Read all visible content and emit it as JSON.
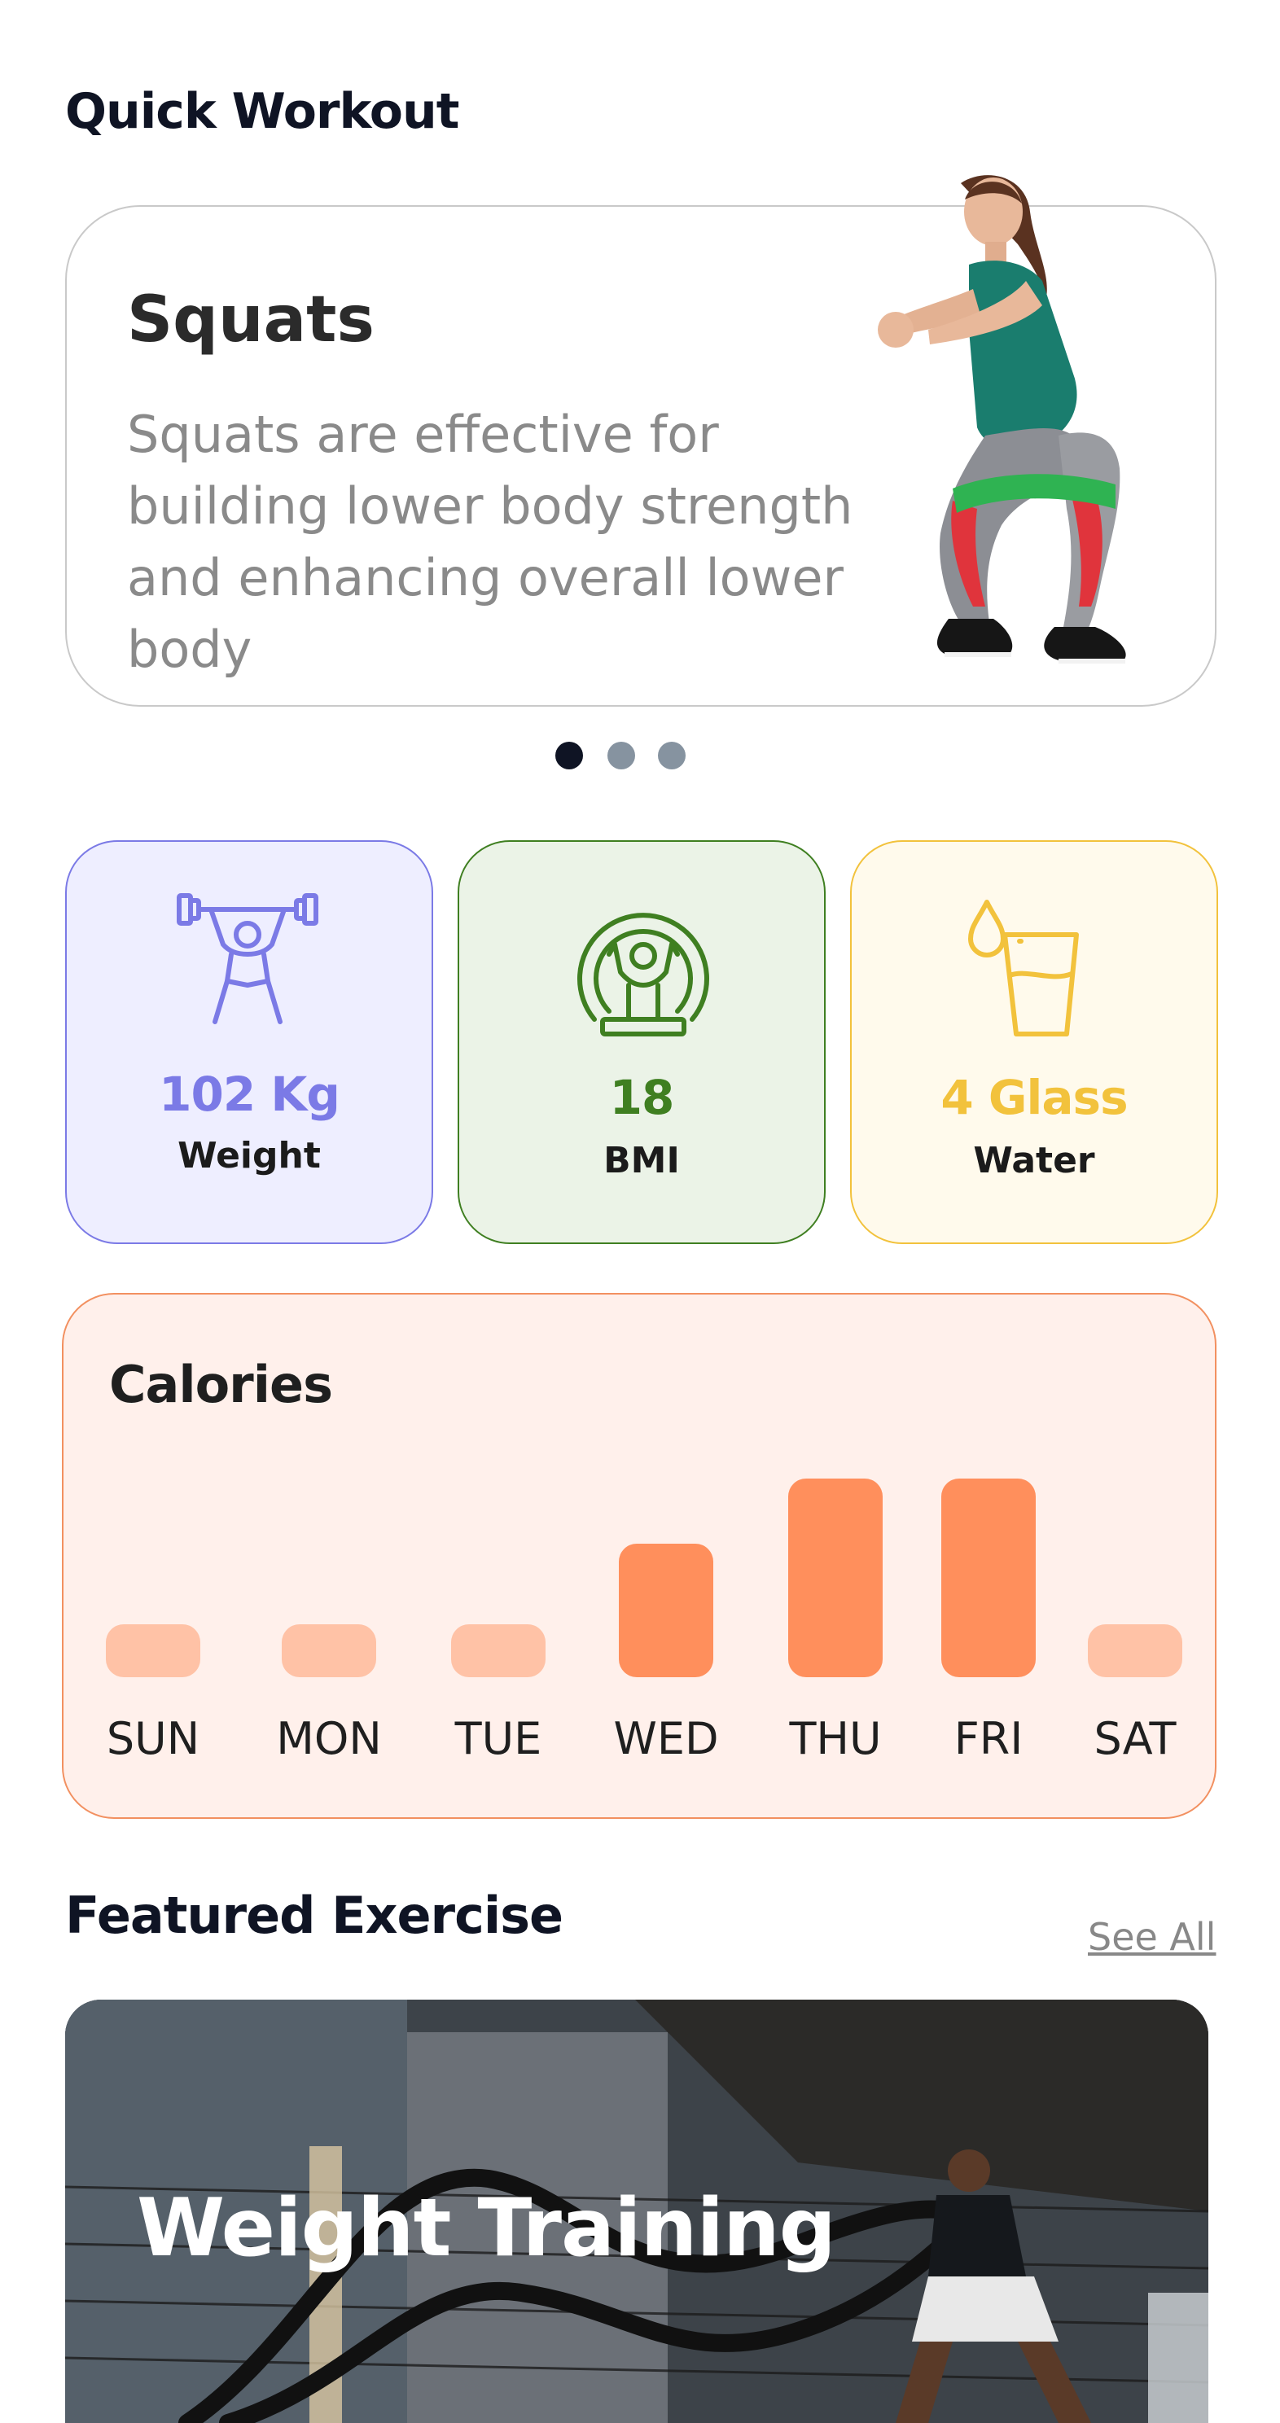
{
  "quick_workout": {
    "section_title": "Quick Workout",
    "card": {
      "title": "Squats",
      "description": "Squats are effective for building lower body strength and enhancing overall lower body"
    },
    "carousel_dots": 3,
    "active_dot": 0
  },
  "stats": [
    {
      "value": "102 Kg",
      "label": "Weight",
      "icon": "weightlifter-icon",
      "accent": "#7b7ae6",
      "bg": "#eeeeff"
    },
    {
      "value": "18",
      "label": "BMI",
      "icon": "bodybuilder-icon",
      "accent": "#3f7f21",
      "bg": "#ebf3e7"
    },
    {
      "value": "4 Glass",
      "label": "Water",
      "icon": "water-glass-icon",
      "accent": "#f2c23c",
      "bg": "#fffaec"
    }
  ],
  "calories": {
    "title": "Calories",
    "days": [
      "SUN",
      "MON",
      "TUE",
      "WED",
      "THU",
      "FRI",
      "SAT"
    ],
    "levels": [
      0.22,
      0.22,
      0.22,
      0.55,
      0.82,
      0.82,
      0.22
    ],
    "colors": {
      "high": "#ff8f5c",
      "low": "#ffc2a6"
    }
  },
  "featured": {
    "section_title": "Featured Exercise",
    "see_all": "See All",
    "card_title": "Weight Training"
  }
}
